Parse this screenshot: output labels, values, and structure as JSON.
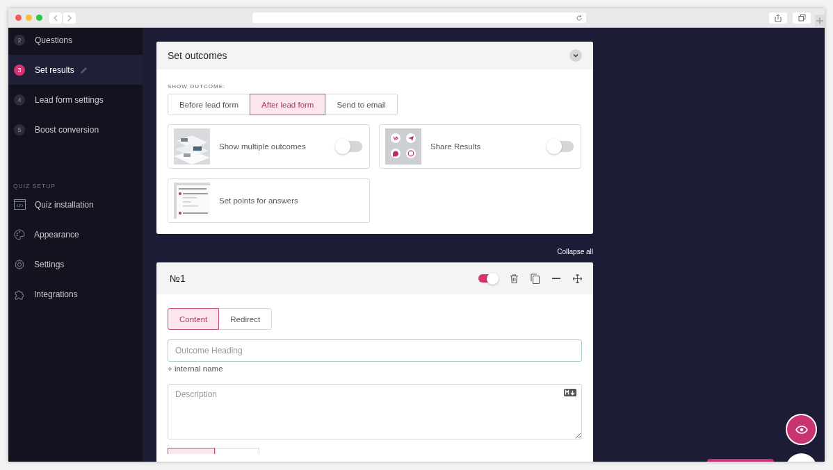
{
  "sidebar": {
    "steps": [
      {
        "number": "2",
        "label": "Questions",
        "selected": false
      },
      {
        "number": "3",
        "label": "Set results",
        "selected": true
      },
      {
        "number": "4",
        "label": "Lead form settings",
        "selected": false
      },
      {
        "number": "5",
        "label": "Boost conversion",
        "selected": false
      }
    ],
    "section_title": "QUIZ SETUP",
    "setup_items": [
      {
        "label": "Quiz installation",
        "kind": "code"
      },
      {
        "label": "Appearance",
        "kind": "palette"
      },
      {
        "label": "Settings",
        "kind": "gear"
      },
      {
        "label": "Integrations",
        "kind": "puzzle"
      }
    ]
  },
  "outcomes_card": {
    "title": "Set outcomes",
    "show_outcome_label": "SHOW OUTCOME:",
    "outcome_options": [
      {
        "label": "Before lead form",
        "selected": false
      },
      {
        "label": "After lead form",
        "selected": true
      },
      {
        "label": "Send to email",
        "selected": false
      }
    ],
    "features": [
      {
        "label": "Show multiple outcomes",
        "kind": "toggle",
        "on": false
      },
      {
        "label": "Share Results",
        "kind": "toggle",
        "thumbnail": {
          "kind": "social"
        },
        "on": false
      },
      {
        "label": "Set points for answers",
        "kind": "plain",
        "thumbnail": {
          "kind": "list"
        }
      }
    ]
  },
  "collapse_all": "Collapse all",
  "result_card": {
    "title": "№1",
    "enabled": true,
    "tabs": [
      {
        "label": "Content",
        "selected": true
      },
      {
        "label": "Redirect",
        "selected": false
      }
    ],
    "heading_placeholder": "Outcome Heading",
    "internal_name_link": "+ internal name",
    "description_placeholder": "Description"
  }
}
